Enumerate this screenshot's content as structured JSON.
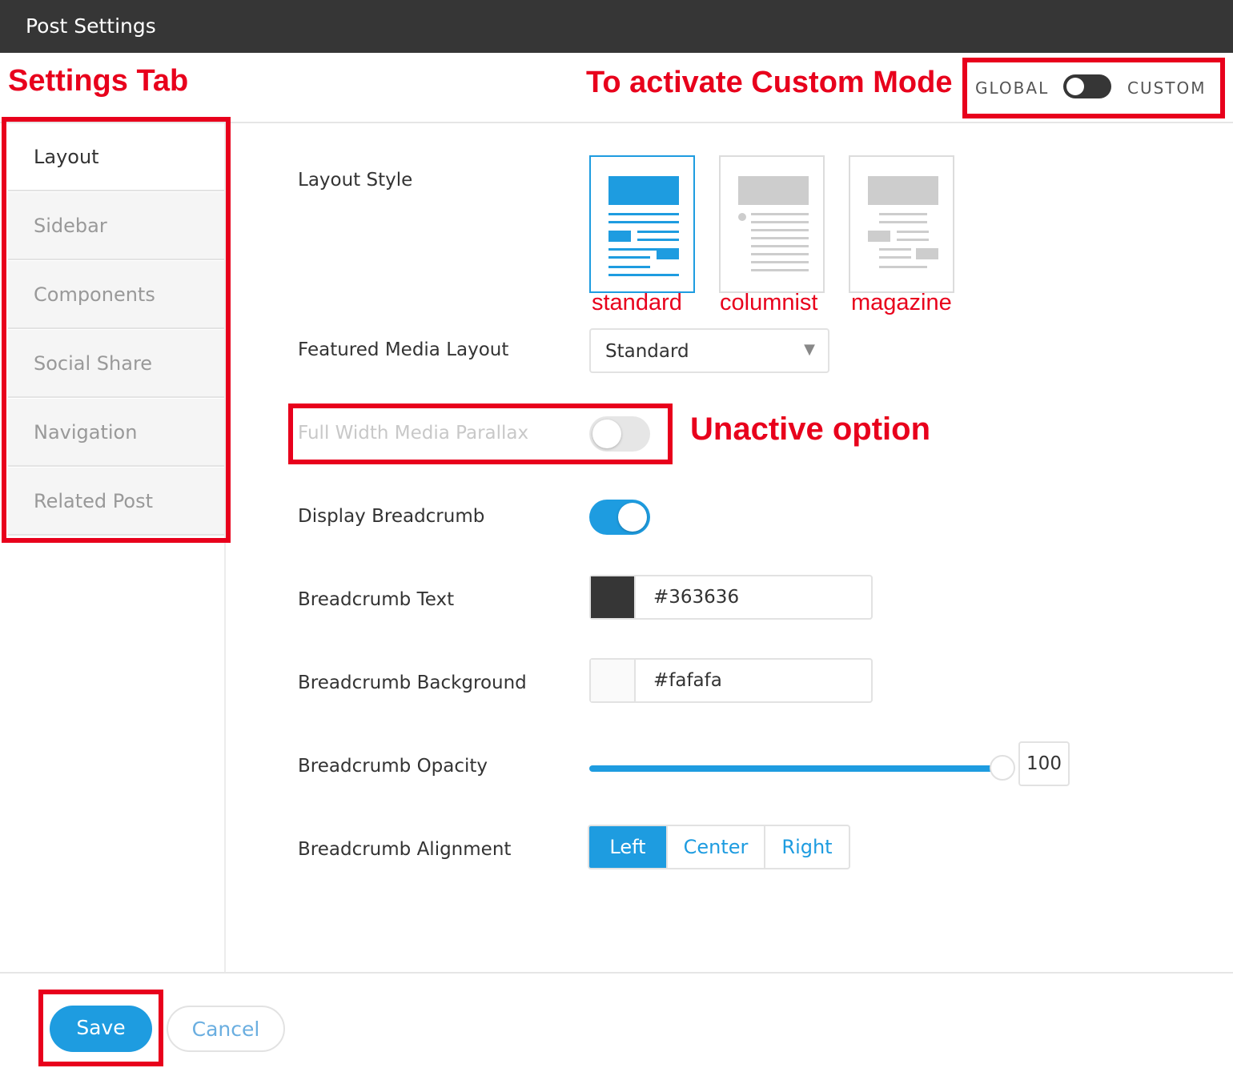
{
  "window": {
    "title": "Post Settings"
  },
  "annotations": {
    "settings_tab": "Settings Tab",
    "custom_mode": "To activate Custom Mode",
    "unactive": "Unactive option"
  },
  "mode_switch": {
    "left_label": "GLOBAL",
    "right_label": "CUSTOM",
    "state": "global"
  },
  "tabs": [
    {
      "label": "Layout",
      "active": true
    },
    {
      "label": "Sidebar",
      "active": false
    },
    {
      "label": "Components",
      "active": false
    },
    {
      "label": "Social Share",
      "active": false
    },
    {
      "label": "Navigation",
      "active": false
    },
    {
      "label": "Related Post",
      "active": false
    }
  ],
  "fields": {
    "layout_style": {
      "label": "Layout Style",
      "options": [
        "standard",
        "columnist",
        "magazine"
      ],
      "selected": "standard"
    },
    "featured_media": {
      "label": "Featured Media Layout",
      "value": "Standard"
    },
    "parallax": {
      "label": "Full Width Media Parallax",
      "enabled": false,
      "disabled": true
    },
    "display_breadcrumb": {
      "label": "Display Breadcrumb",
      "enabled": true
    },
    "breadcrumb_text": {
      "label": "Breadcrumb Text",
      "value": "#363636"
    },
    "breadcrumb_background": {
      "label": "Breadcrumb Background",
      "value": "#fafafa"
    },
    "breadcrumb_opacity": {
      "label": "Breadcrumb Opacity",
      "value": "100"
    },
    "breadcrumb_alignment": {
      "label": "Breadcrumb Alignment",
      "options": [
        "Left",
        "Center",
        "Right"
      ],
      "selected": "Left"
    }
  },
  "footer": {
    "save": "Save",
    "cancel": "Cancel"
  },
  "colors": {
    "accent": "#1e9ce0",
    "annotation": "#e8001c",
    "titlebar": "#363636"
  }
}
